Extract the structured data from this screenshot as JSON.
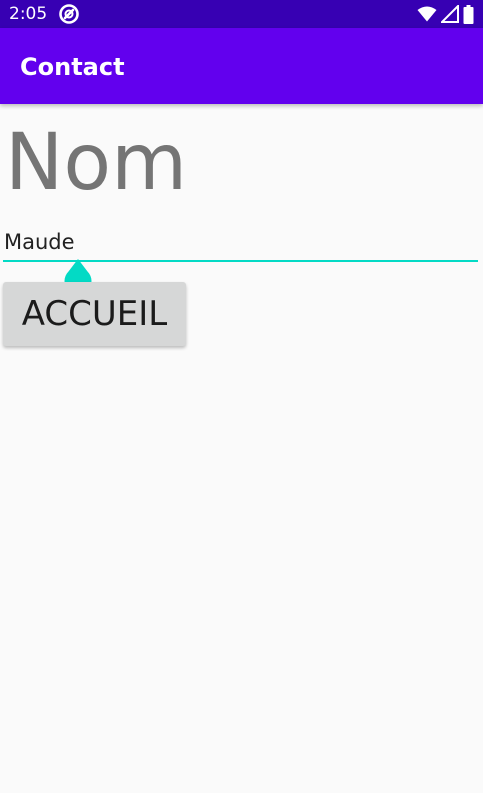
{
  "status_bar": {
    "time": "2:05",
    "icons": [
      "app-notification-icon",
      "wifi-icon",
      "signal-icon",
      "battery-icon"
    ]
  },
  "app_bar": {
    "title": "Contact"
  },
  "main": {
    "heading": "Nom",
    "name_field": {
      "value": "Maude"
    },
    "home_button_label": "ACCUEIL"
  },
  "colors": {
    "status_bar": "#3700b3",
    "app_bar": "#6200ee",
    "accent": "#03dac5",
    "background": "#fafafa",
    "button": "#d6d7d7"
  }
}
